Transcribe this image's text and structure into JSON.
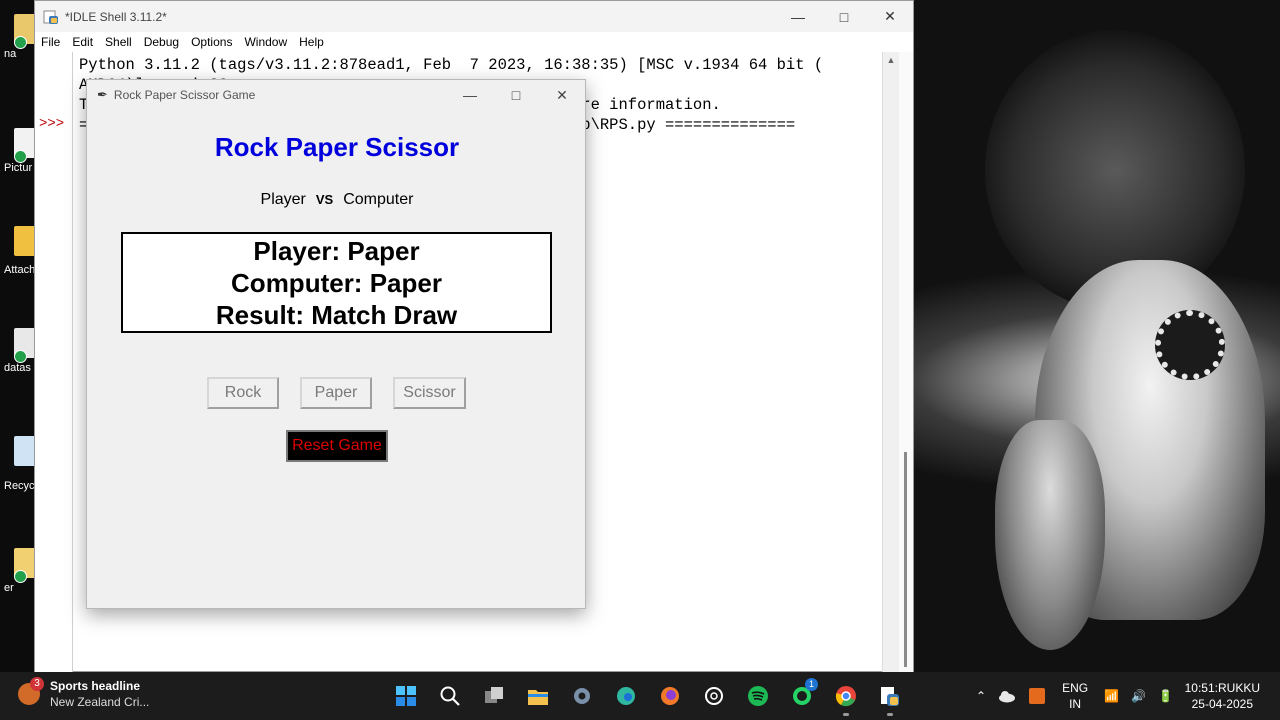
{
  "idle": {
    "title": "*IDLE Shell 3.11.2*",
    "menu": [
      "File",
      "Edit",
      "Shell",
      "Debug",
      "Options",
      "Window",
      "Help"
    ],
    "prompt": ">>>",
    "lines": [
      "Python 3.11.2 (tags/v3.11.2:878ead1, Feb  7 2023, 16:38:35) [MSC v.1934 64 bit (",
      "AMD64)] on win32",
      "T                                               for more information.",
      "",
      "=                                               Desktop\\RPS.py =============="
    ]
  },
  "game": {
    "window_title": "Rock Paper Scissor Game",
    "heading": "Rock Paper Scissor",
    "player_label": "Player",
    "vs_label": "VS",
    "computer_label": "Computer",
    "result_player": "Player: Paper",
    "result_computer": "Computer: Paper",
    "result_outcome": "Result: Match Draw",
    "btn_rock": "Rock",
    "btn_paper": "Paper",
    "btn_scissor": "Scissor",
    "btn_reset": "Reset Game"
  },
  "desktop_icons": [
    {
      "label": "na",
      "color": "#e8c86a"
    },
    {
      "label": "Pictur",
      "color": "#f2f2f2"
    },
    {
      "label": "Attach",
      "color": "#f0c040"
    },
    {
      "label": "datas",
      "color": "#e8e8e8"
    },
    {
      "label": "Recyc",
      "color": "#cfe3f5"
    },
    {
      "label": "er",
      "color": "#f0d070"
    }
  ],
  "taskbar": {
    "news_badge": "3",
    "news_headline": "Sports headline",
    "news_sub": "New Zealand Cri...",
    "whatsapp_badge": "1",
    "lang_top": "ENG",
    "lang_bottom": "IN",
    "time": "10:51:RUKKU",
    "date": "25-04-2025",
    "icons": [
      {
        "name": "windows-start-icon",
        "color": "#2b8ce8"
      },
      {
        "name": "search-icon",
        "color": "#ffffff"
      },
      {
        "name": "task-view-icon",
        "color": "#d0d0d0"
      },
      {
        "name": "file-explorer-icon",
        "color": "#f2c14e"
      },
      {
        "name": "settings-icon",
        "color": "#7a8fa8"
      },
      {
        "name": "edge-icon",
        "color": "#2fb7a0"
      },
      {
        "name": "firefox-icon",
        "color": "#f07a2a"
      },
      {
        "name": "chatgpt-icon",
        "color": "#ffffff"
      },
      {
        "name": "spotify-icon",
        "color": "#1db954"
      },
      {
        "name": "whatsapp-icon",
        "color": "#25d366"
      },
      {
        "name": "chrome-icon",
        "color": "#e8453c"
      },
      {
        "name": "python-idle-icon",
        "color": "#3d7ab8"
      }
    ]
  }
}
